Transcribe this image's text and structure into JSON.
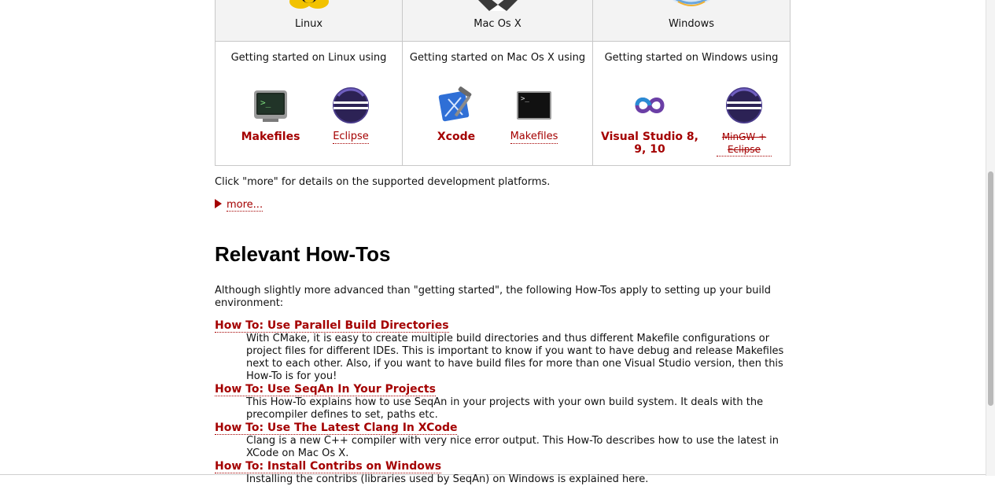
{
  "platforms": [
    {
      "name": "Linux",
      "getting_started": "Getting started on Linux using",
      "tools": [
        {
          "label": "Makefiles",
          "icon": "terminal-icon",
          "style": "bold"
        },
        {
          "label": "Eclipse",
          "icon": "eclipse-icon",
          "style": "normal"
        }
      ]
    },
    {
      "name": "Mac Os X",
      "getting_started": "Getting started on Mac Os X using",
      "tools": [
        {
          "label": "Xcode",
          "icon": "xcode-icon",
          "style": "bold"
        },
        {
          "label": "Makefiles",
          "icon": "terminal-icon",
          "style": "normal"
        }
      ]
    },
    {
      "name": "Windows",
      "getting_started": "Getting started on Windows using",
      "tools": [
        {
          "label": "Visual Studio 8, 9, 10",
          "icon": "visual-studio-icon",
          "style": "bold"
        },
        {
          "label": "MinGW + Eclipse",
          "icon": "eclipse-icon",
          "style": "struck"
        }
      ]
    }
  ],
  "note": "Click \"more\" for details on the supported development platforms.",
  "more_link": "more...",
  "section_title": "Relevant How-Tos",
  "intro": "Although slightly more advanced than \"getting started\", the following How-Tos apply to setting up your build environment:",
  "howtos": [
    {
      "title": "How To: Use Parallel Build Directories",
      "desc": "With CMake, it is easy to create multiple build directories and thus different Makefile configurations or project files for different IDEs. This is important to know if you want to have debug and release Makefiles next to each other. Also, if you want to have build files for more than one Visual Studio version, then this How-To is for you!"
    },
    {
      "title": "How To: Use SeqAn In Your Projects",
      "desc": "This How-To explains how to use SeqAn in your projects with your own build system. It deals with the precompiler defines to set, paths etc."
    },
    {
      "title": "How To: Use The Latest Clang In XCode",
      "desc": "Clang is a new C++ compiler with very nice error output. This How-To describes how to use the latest in XCode on Mac Os X."
    },
    {
      "title": "How To: Install Contribs on Windows",
      "desc": "Installing the contribs (libraries used by SeqAn) on Windows is explained here."
    }
  ],
  "colors": {
    "link": "#a40000",
    "header_bg": "#f3f3f3",
    "border": "#c8c8c8"
  }
}
